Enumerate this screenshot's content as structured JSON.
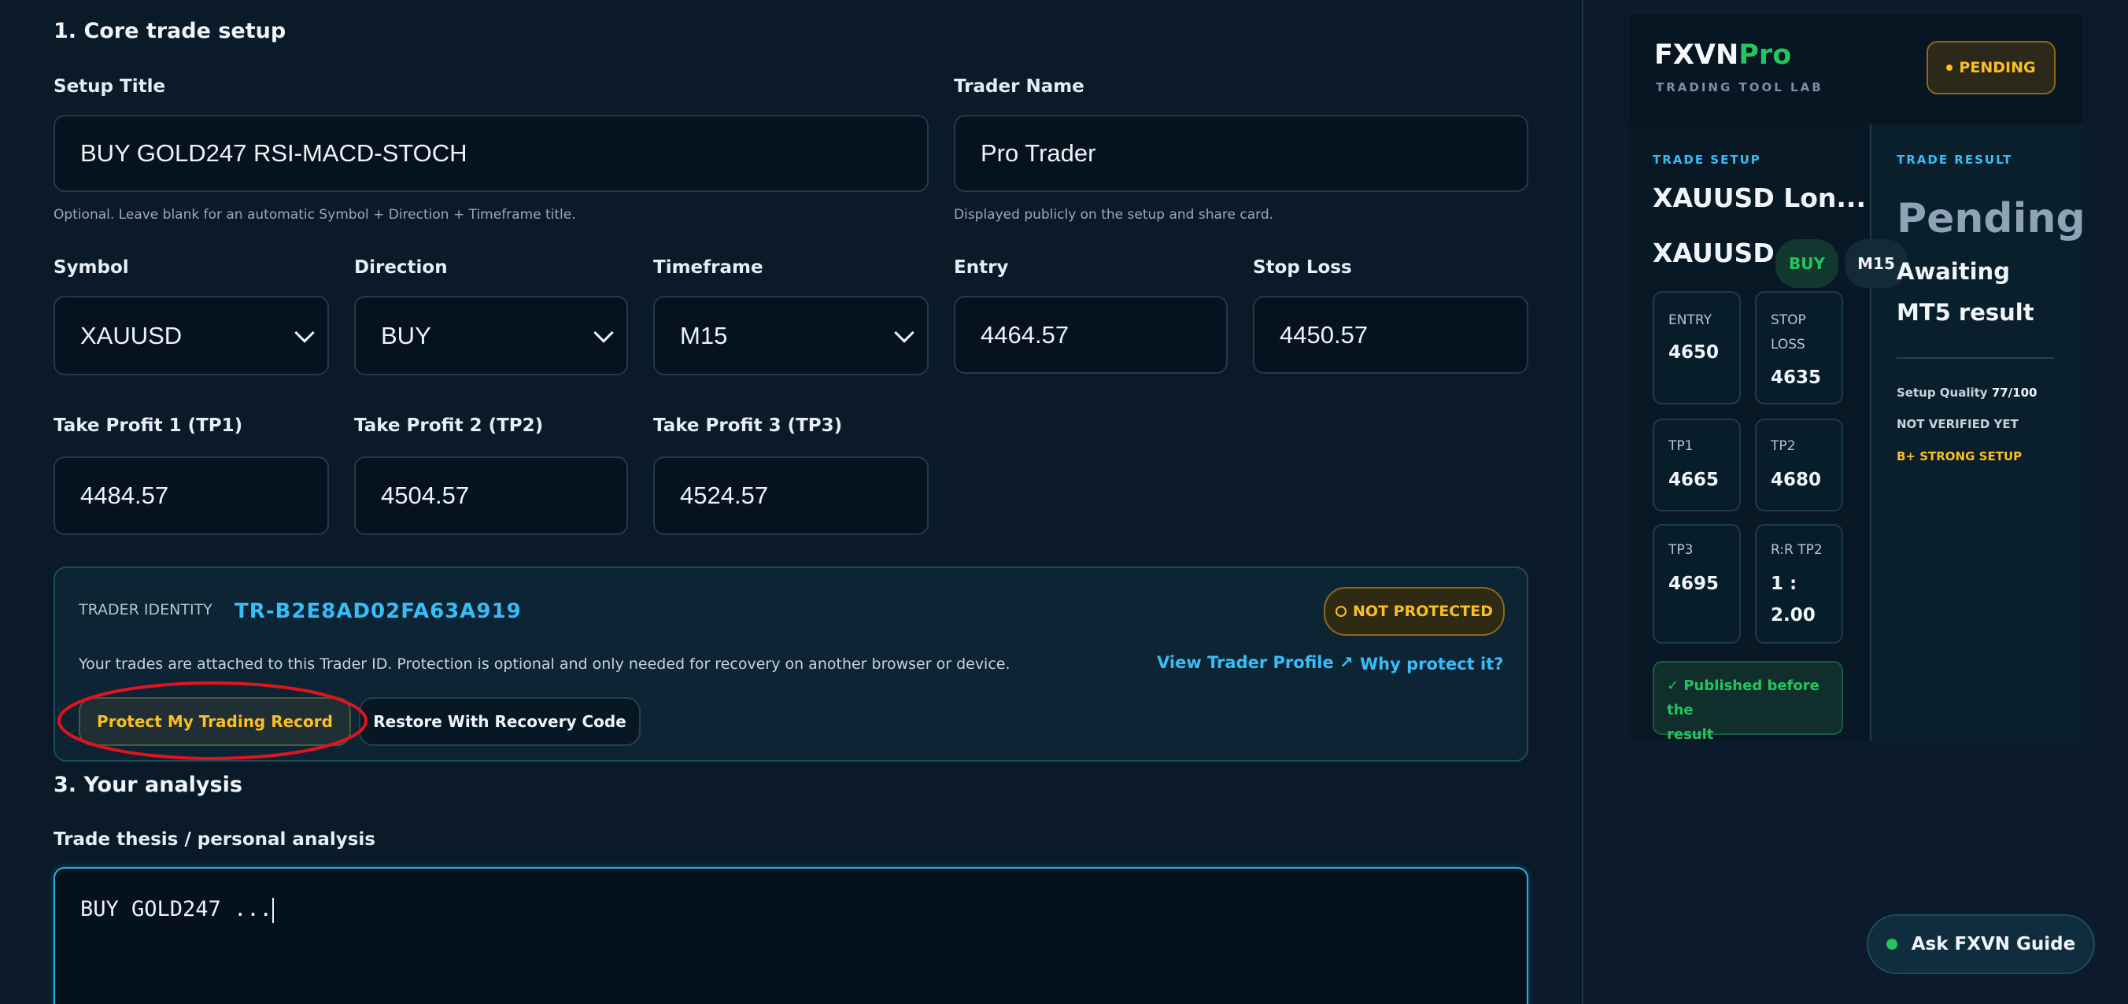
{
  "section_core": {
    "title": "1. Core trade setup"
  },
  "setup_title": {
    "label": "Setup Title",
    "value": "BUY GOLD247 RSI-MACD-STOCH",
    "hint": "Optional. Leave blank for an automatic Symbol + Direction + Timeframe title."
  },
  "trader_name": {
    "label": "Trader Name",
    "value": "Pro Trader",
    "hint": "Displayed publicly on the setup and share card."
  },
  "symbol": {
    "label": "Symbol",
    "value": "XAUUSD"
  },
  "direction": {
    "label": "Direction",
    "value": "BUY"
  },
  "timeframe": {
    "label": "Timeframe",
    "value": "M15"
  },
  "entry": {
    "label": "Entry",
    "value": "4464.57"
  },
  "stop_loss": {
    "label": "Stop Loss",
    "value": "4450.57"
  },
  "tp1": {
    "label": "Take Profit 1 (TP1)",
    "value": "4484.57"
  },
  "tp2": {
    "label": "Take Profit 2 (TP2)",
    "value": "4504.57"
  },
  "tp3": {
    "label": "Take Profit 3 (TP3)",
    "value": "4524.57"
  },
  "identity": {
    "label": "TRADER IDENTITY",
    "id": "TR-B2E8AD02FA63A919",
    "status": "NOT PROTECTED",
    "description": "Your trades are attached to this Trader ID. Protection is optional and only needed for recovery on another browser or device.",
    "view_profile": "View Trader Profile ↗",
    "why_protect": "Why protect it?",
    "protect_button": "Protect My Trading Record",
    "restore_button": "Restore With Recovery Code"
  },
  "section_analysis": {
    "title": "3. Your analysis"
  },
  "thesis": {
    "label": "Trade thesis / personal analysis",
    "value": "BUY GOLD247 ..."
  },
  "card": {
    "brand_main": "FXVN",
    "brand_accent": "Pro",
    "subtitle": "TRADING TOOL LAB",
    "status_badge": "PENDING",
    "setup_heading": "TRADE SETUP",
    "result_heading": "TRADE RESULT",
    "setup_title": "XAUUSD Lon...",
    "symbol": "XAUUSD",
    "direction": "BUY",
    "timeframe": "M15",
    "tiles": {
      "entry_label": "ENTRY",
      "entry_value": "4650",
      "sl_label_1": "STOP",
      "sl_label_2": "LOSS",
      "sl_value": "4635",
      "tp1_label": "TP1",
      "tp1_value": "4665",
      "tp2_label": "TP2",
      "tp2_value": "4680",
      "tp3_label": "TP3",
      "tp3_value": "4695",
      "rr_label": "R:R TP2",
      "rr_value_1": "1 :",
      "rr_value_2": "2.00"
    },
    "published_1": "✓ Published before the",
    "published_2": "result",
    "result_title": "Pending",
    "result_line1": "Awaiting",
    "result_line2": "MT5 result",
    "quality_label": "Setup Quality",
    "quality_value": "77/100",
    "verified": "NOT VERIFIED YET",
    "grade": "B+ STRONG SETUP"
  },
  "guide_button": "Ask FXVN Guide",
  "colors": {
    "background": "#0b1a29",
    "accent_cyan": "#38bdf8",
    "accent_green": "#22c55e",
    "accent_gold": "#fbbf24",
    "highlight_ring": "#e0141b"
  }
}
